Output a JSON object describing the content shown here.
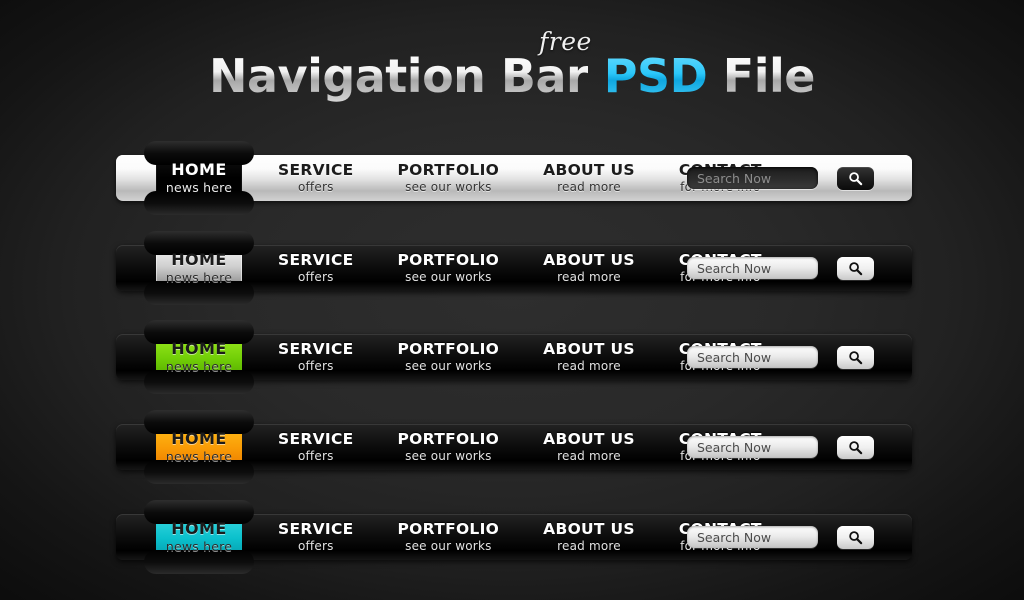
{
  "title": {
    "main_part1": "Navigation Bar",
    "accent": "PSD",
    "main_part2": "File",
    "superscript": "free",
    "accent_color": "#2cc8fa"
  },
  "menu_items": [
    {
      "title": "HOME",
      "sub": "news here"
    },
    {
      "title": "SERVICE",
      "sub": "offers"
    },
    {
      "title": "PORTFOLIO",
      "sub": "see our works"
    },
    {
      "title": "ABOUT US",
      "sub": "read more"
    },
    {
      "title": "CONTACT",
      "sub": "for more info"
    }
  ],
  "search": {
    "placeholder": "Search Now",
    "value": "",
    "button_icon": "search-icon"
  },
  "bars": [
    {
      "style": "light",
      "active_tab_style": "black",
      "accent_color": "#000000",
      "label": "light-bar-black-tab"
    },
    {
      "style": "dark",
      "active_tab_style": "silver",
      "accent_color": "#dddddd",
      "label": "dark-bar-silver-tab"
    },
    {
      "style": "dark",
      "active_tab_style": "green",
      "accent_color": "#8ce41a",
      "label": "dark-bar-green-tab"
    },
    {
      "style": "dark",
      "active_tab_style": "orange",
      "accent_color": "#f99b06",
      "label": "dark-bar-orange-tab"
    },
    {
      "style": "dark",
      "active_tab_style": "cyan",
      "accent_color": "#0bc0cc",
      "label": "dark-bar-cyan-tab"
    }
  ],
  "background_color": "#292929"
}
